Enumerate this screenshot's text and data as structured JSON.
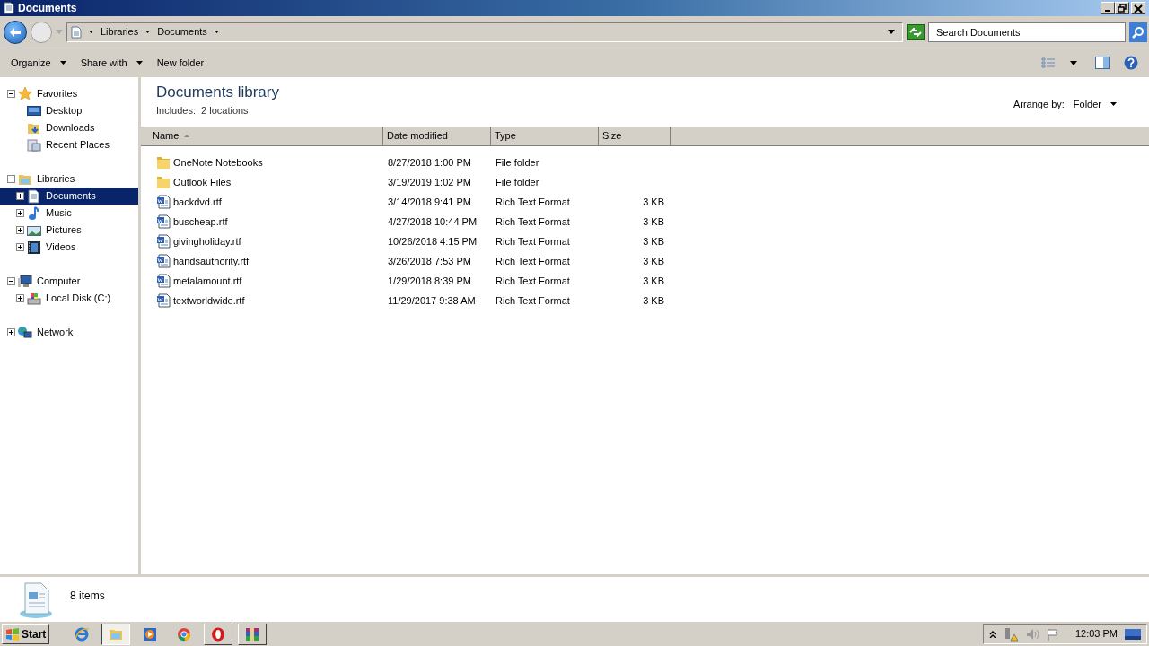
{
  "window": {
    "title": "Documents"
  },
  "address_bar": {
    "breadcrumbs": [
      "Libraries",
      "Documents"
    ],
    "search": {
      "placeholder": "Search Documents"
    }
  },
  "toolbar": {
    "buttons": [
      {
        "label": "Organize",
        "dropdown": true
      },
      {
        "label": "Share with",
        "dropdown": true
      },
      {
        "label": "New folder",
        "dropdown": false
      }
    ]
  },
  "sidebar": {
    "groups": [
      {
        "label": "Favorites",
        "kind": "star",
        "expanded": true,
        "selected": false,
        "children": [
          {
            "label": "Desktop",
            "kind": "desktop",
            "selected": false
          },
          {
            "label": "Downloads",
            "kind": "downloads",
            "selected": false
          },
          {
            "label": "Recent Places",
            "kind": "recent",
            "selected": false
          }
        ]
      },
      {
        "label": "Libraries",
        "kind": "library",
        "expanded": true,
        "selected": false,
        "children": [
          {
            "label": "Documents",
            "kind": "document",
            "expanded": false,
            "selected": true
          },
          {
            "label": "Music",
            "kind": "music",
            "expanded": false,
            "selected": false
          },
          {
            "label": "Pictures",
            "kind": "pictures",
            "expanded": false,
            "selected": false
          },
          {
            "label": "Videos",
            "kind": "videos",
            "expanded": false,
            "selected": false
          }
        ]
      },
      {
        "label": "Computer",
        "kind": "computer",
        "expanded": true,
        "selected": false,
        "children": [
          {
            "label": "Local Disk (C:)",
            "kind": "disk",
            "expanded": false,
            "selected": false
          }
        ]
      },
      {
        "label": "Network",
        "kind": "network",
        "expanded": false,
        "selected": false
      }
    ]
  },
  "library_header": {
    "title": "Documents library",
    "includes_label": "Includes:",
    "includes_link": "2 locations",
    "arrange_label": "Arrange by:",
    "arrange_value": "Folder"
  },
  "table": {
    "columns": [
      {
        "label": "Name",
        "sorted": true
      },
      {
        "label": "Date modified",
        "sorted": false
      },
      {
        "label": "Type",
        "sorted": false
      },
      {
        "label": "Size",
        "sorted": false
      }
    ],
    "rows": [
      {
        "kind": "folder",
        "name": "OneNote Notebooks",
        "date": "8/27/2018 1:00 PM",
        "type": "File folder"
      },
      {
        "kind": "folder",
        "name": "Outlook Files",
        "date": "3/19/2019 1:02 PM",
        "type": "File folder"
      },
      {
        "kind": "rtf",
        "name": "backdvd.rtf",
        "date": "3/14/2018 9:41 PM",
        "type": "Rich Text Format",
        "size": "3 KB"
      },
      {
        "kind": "rtf",
        "name": "buscheap.rtf",
        "date": "4/27/2018 10:44 PM",
        "type": "Rich Text Format",
        "size": "3 KB"
      },
      {
        "kind": "rtf",
        "name": "givingholiday.rtf",
        "date": "10/26/2018 4:15 PM",
        "type": "Rich Text Format",
        "size": "3 KB"
      },
      {
        "kind": "rtf",
        "name": "handsauthority.rtf",
        "date": "3/26/2018 7:53 PM",
        "type": "Rich Text Format",
        "size": "3 KB"
      },
      {
        "kind": "rtf",
        "name": "metalamount.rtf",
        "date": "1/29/2018 8:39 PM",
        "type": "Rich Text Format",
        "size": "3 KB"
      },
      {
        "kind": "rtf",
        "name": "textworldwide.rtf",
        "date": "11/29/2017 9:38 AM",
        "type": "Rich Text Format",
        "size": "3 KB"
      }
    ]
  },
  "status_bar": {
    "count": "8 items"
  },
  "taskbar": {
    "start": "Start",
    "apps": [
      {
        "kind": "ie",
        "selected": false
      },
      {
        "kind": "explorer",
        "selected": true
      },
      {
        "kind": "media",
        "selected": false
      },
      {
        "kind": "chrome",
        "selected": false
      },
      {
        "kind": "opera",
        "selected": false
      },
      {
        "kind": "winrar",
        "selected": false
      }
    ],
    "clock": "12:03 PM"
  }
}
